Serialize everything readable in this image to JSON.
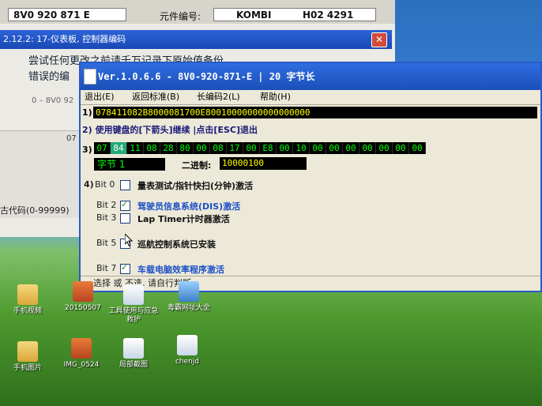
{
  "background_window": {
    "part_number": "8V0 920 871 E",
    "component_label": "元件编号:",
    "component_value_1": "KOMBI",
    "component_value_2": "H02 4291",
    "title": "2.12.2: 17-仪表板,  控制器编码",
    "warning_line1": "尝试任何更改之前请千万记录下原始值备份。",
    "warning_line2": "错误的编",
    "small_code": "0 – 8V0 92",
    "side_number": "07",
    "code_label": "古代码(0-99999)"
  },
  "dialog": {
    "title": "Ver.1.0.6.6 -  8V0-920-871-E | 20 字节长",
    "menu": [
      "退出(E)",
      "返回标准(B)",
      "长编码2(L)",
      "帮助(H)"
    ],
    "row1_label": "1)",
    "hex_string": "078411082B8000081700E80010000000000000000",
    "row2_label": "2)",
    "row2_text": "使用键盘的[下箭头]继续 |点击[ESC]退出",
    "row3_label": "3)",
    "bytes": [
      "07",
      "84",
      "11",
      "08",
      "28",
      "80",
      "00",
      "08",
      "17",
      "00",
      "E8",
      "00",
      "10",
      "00",
      "00",
      "00",
      "00",
      "00",
      "00",
      "00"
    ],
    "selected_byte_index": 1,
    "byte_name": "字节 1",
    "binary_label": "二进制:",
    "binary_value": "10000100",
    "bits": [
      {
        "label": "Bit 0",
        "text": "量表测试/指针快扫(分钟)激活",
        "checked": false,
        "blue": false
      },
      {
        "label": "Bit 2",
        "text": "驾驶员信息系统(DIS)激活",
        "checked": true,
        "blue": true
      },
      {
        "label": "Bit 3",
        "text": "Lap Timer计时器激活",
        "checked": false,
        "blue": false
      },
      {
        "label": "Bit 5",
        "text": "巡航控制系统已安装",
        "checked": false,
        "blue": false
      },
      {
        "label": "Bit 7",
        "text": "车载电脑效率程序激活",
        "checked": true,
        "blue": true
      }
    ],
    "row4_label": "4)",
    "status_text": "选择 或 不选, 请自行判断"
  },
  "desktop_icons": [
    {
      "label": "手机视频",
      "icon": "folder-icon"
    },
    {
      "label": "20150507",
      "icon": "image-icon"
    },
    {
      "label": "工具使用与应急救护",
      "icon": "document-icon"
    },
    {
      "label": "毒霸网址大全",
      "icon": "app-icon"
    },
    {
      "label": "手机图片",
      "icon": "folder-icon"
    },
    {
      "label": "IMG_0524",
      "icon": "image-icon"
    },
    {
      "label": "局部截图",
      "icon": "scissors-icon"
    },
    {
      "label": "chenjd",
      "icon": "document-icon"
    }
  ]
}
